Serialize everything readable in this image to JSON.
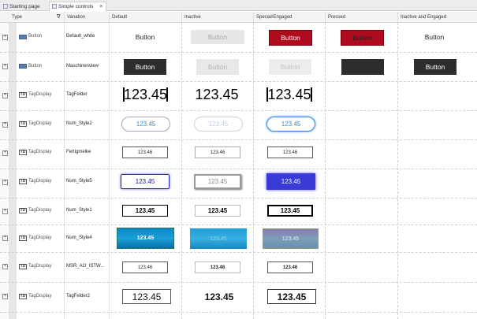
{
  "tabs": [
    {
      "label": "Starting page",
      "active": false
    },
    {
      "label": "Simple controls",
      "active": true,
      "close": "×"
    }
  ],
  "columns": {
    "type": "Type",
    "filter_icon": "funnel-icon",
    "variation": "Variation",
    "default": "Default",
    "inactive": "Inactive",
    "special": "Special/Engaged",
    "pressed": "Pressed",
    "inactive_engaged": "Inactive and Engaged"
  },
  "rows": [
    {
      "type": "Button",
      "variation": "Default_white",
      "cells": {
        "default": "Button",
        "inactive": "Button",
        "special": "Button",
        "pressed": "Button",
        "inactive_engaged": "Button"
      }
    },
    {
      "type": "Button",
      "variation": "Maschinenview",
      "cells": {
        "default": "Button",
        "inactive": "Button",
        "special": "Button",
        "pressed": "",
        "inactive_engaged": "Button"
      }
    },
    {
      "type": "TagDisplay",
      "variation": "TagFelder",
      "cells": {
        "default": "123.45",
        "inactive": "123.45",
        "special": "123.45"
      }
    },
    {
      "type": "TagDisplay",
      "variation": "Num_Style2",
      "cells": {
        "default": "123.45",
        "inactive": "123.45",
        "special": "123.45"
      }
    },
    {
      "type": "TagDisplay",
      "variation": "Fertigmelke",
      "cells": {
        "default": "123.46",
        "inactive": "123.46",
        "special": "123.46"
      }
    },
    {
      "type": "TagDisplay",
      "variation": "Num_Style5",
      "cells": {
        "default": "123.45",
        "inactive": "123.45",
        "special": "123.45"
      }
    },
    {
      "type": "TagDisplay",
      "variation": "Num_Style1",
      "cells": {
        "default": "123.45",
        "inactive": "123.45",
        "special": "123.45"
      }
    },
    {
      "type": "TagDisplay",
      "variation": "Num_Style4",
      "cells": {
        "default": "123.45",
        "inactive": "123.45",
        "special": "123.45"
      }
    },
    {
      "type": "TagDisplay",
      "variation": "MSR_AO_ISTW...",
      "cells": {
        "default": "123.46",
        "inactive": "123.46",
        "special": "123.46"
      }
    },
    {
      "type": "TagDisplay",
      "variation": "TagFelder2",
      "cells": {
        "default": "123.45",
        "inactive": "123.45",
        "special": "123.45"
      }
    }
  ],
  "icons": {
    "expander": "+",
    "tagdisplay": "TD"
  },
  "colors": {
    "accent_red": "#b00a1e",
    "dark_button": "#2e2e2e",
    "blue_outline": "#3a3ad6",
    "cyan_gradient": "#1aa0d8"
  }
}
